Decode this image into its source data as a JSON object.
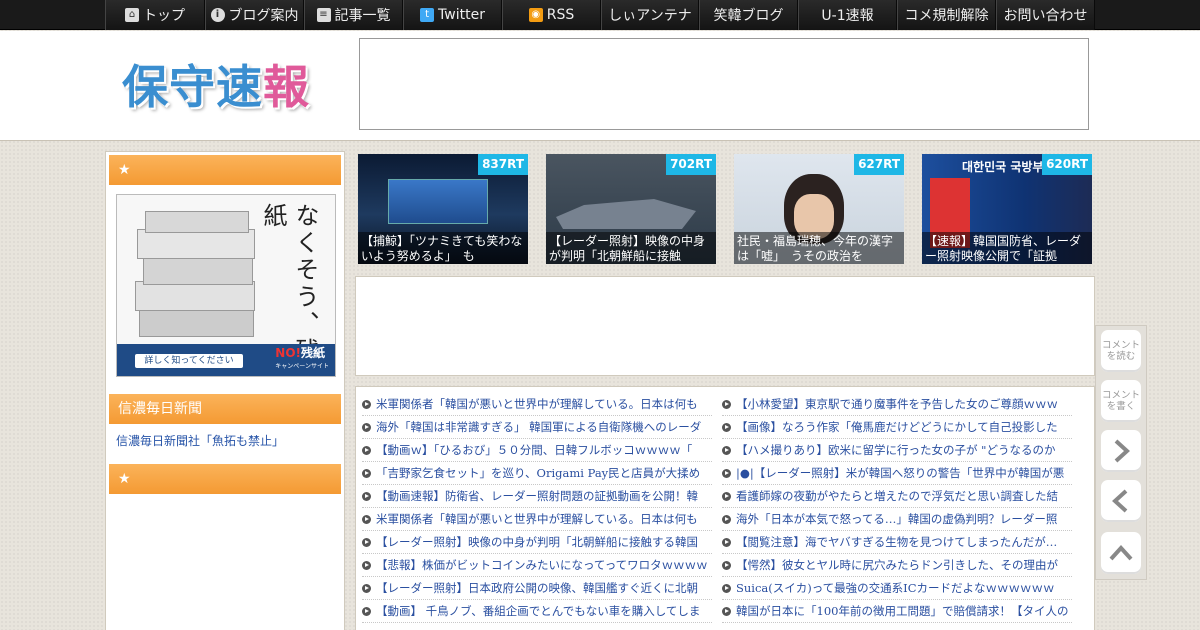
{
  "nav": [
    {
      "label": "トップ",
      "icon": "home-icon"
    },
    {
      "label": "ブログ案内",
      "icon": "info-icon"
    },
    {
      "label": "記事一覧",
      "icon": "list-icon"
    },
    {
      "label": "Twitter",
      "icon": "twitter-icon"
    },
    {
      "label": "RSS",
      "icon": "rss-icon"
    },
    {
      "label": "しぃアンテナ"
    },
    {
      "label": "笑韓ブログ"
    },
    {
      "label": "U-1速報"
    },
    {
      "label": "コメ規制解除"
    },
    {
      "label": "お問い合わせ"
    }
  ],
  "site": {
    "logo_main": "保守速",
    "logo_accent": "報"
  },
  "sidebar": {
    "widget1_title": "★",
    "banner": {
      "vertical_text": "なくそう、残紙",
      "more": "詳しく知ってください",
      "badge_no": "NO!",
      "badge_text": "残紙",
      "badge_sub": "キャンペーンサイト"
    },
    "widget2_title": "信濃毎日新聞",
    "widget2_link": "信濃毎日新聞社「魚拓も禁止」",
    "widget3_title": "★"
  },
  "thumbs": [
    {
      "rt": "837RT",
      "caption": "【捕鯨】「ツナミきても笑わないよう努めるよ」　も"
    },
    {
      "rt": "702RT",
      "caption": "【レーダー照射】映像の中身が判明「北朝鮮船に接触"
    },
    {
      "rt": "627RT",
      "caption": "社民・福島瑞穂、今年の漢字は「嘘」　うその政治を"
    },
    {
      "rt": "620RT",
      "caption": "【速報】韓国国防省、レーダー照射映像公開で「証拠",
      "screen_text": "대한민국 국방부"
    }
  ],
  "articles_left": [
    "米軍関係者「韓国が悪いと世界中が理解している。日本は何も",
    "海外「韓国は非常識すぎる」 韓国軍による自衛隊機へのレーダ",
    "【動画ｗ】「ひるおび」５０分間、日韓フルボッコｗｗｗｗ「",
    "「吉野家乞食セット」を巡り、Origami Pay民と店員が大揉め",
    "【動画速報】防衛省、レーダー照射問題の証拠動画を公開！韓",
    "米軍関係者「韓国が悪いと世界中が理解している。日本は何も",
    "【レーダー照射】映像の中身が判明「北朝鮮船に接触する韓国",
    "【悲報】株価がビットコインみたいになってってワロタｗｗｗｗ",
    "【レーダー照射】日本政府公開の映像、韓国艦すぐ近くに北朝",
    "【動画】 千鳥ノブ、番組企画でとんでもない車を購入してしま"
  ],
  "articles_right": [
    "【小林愛望】東京駅で通り魔事件を予告した女のご尊顔ｗｗｗ",
    "【画像】なろう作家「俺馬鹿だけどどうにかして自己投影した",
    "【ハメ撮りあり】欧米に留学に行った女の子が \"どうなるのか",
    "|●|【レーダー照射】米が韓国へ怒りの警告「世界中が韓国が悪",
    "看護師嫁の夜勤がやたらと増えたので浮気だと思い調査した結",
    "海外「日本が本気で怒ってる…」韓国の虚偽判明？レーダー照",
    "【閲覧注意】海でヤバすぎる生物を見つけてしまったんだが…",
    "【愕然】彼女とヤル時に尻穴みたらドン引きした、その理由が",
    "Suica(スイカ)って最強の交通系ICカードだよなｗｗｗｗｗｗ",
    "韓国が日本に「100年前の徴用工問題」で賠償請求！【タイ人の"
  ],
  "float": {
    "read_comments": "コメントを読む",
    "write_comment": "コメントを書く"
  },
  "colors": {
    "accent_orange": "#f49a33",
    "rt_badge": "#1eb7e6",
    "link_blue": "#2754a8"
  }
}
